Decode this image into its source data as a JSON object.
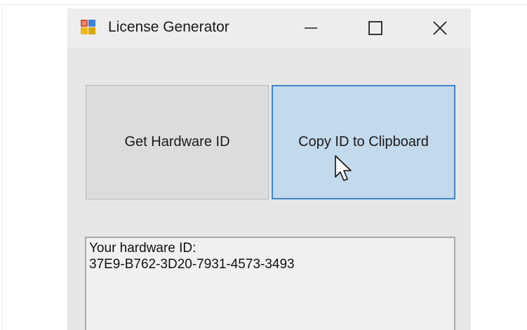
{
  "window": {
    "title": "License Generator"
  },
  "titlebar": {
    "icons": [
      "app-icon",
      "minimize-icon",
      "maximize-icon",
      "close-icon"
    ]
  },
  "buttons": {
    "get_hardware_id": "Get Hardware ID",
    "copy_id": "Copy ID to Clipboard"
  },
  "output": {
    "label": "Your hardware ID:",
    "value": "37E9-B762-3D20-7931-4573-3493"
  },
  "colors": {
    "window_bg": "#e6e6e6",
    "button_default": "#dcdcdc",
    "button_hover": "#c3d9ec",
    "button_hover_border": "#3e86c7"
  }
}
